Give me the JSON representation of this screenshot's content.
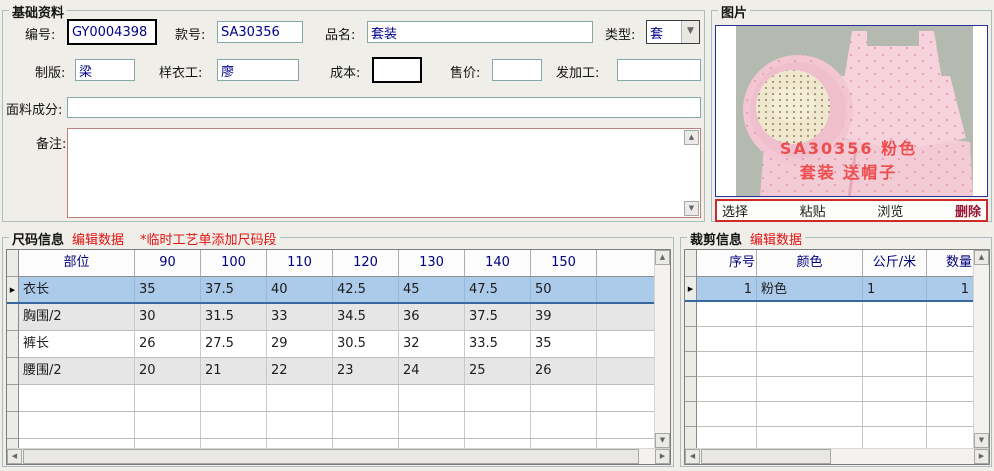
{
  "basic_info": {
    "title": "基础资料",
    "fields": {
      "code_label": "编号:",
      "code_value": "GY0004398",
      "style_label": "款号:",
      "style_value": "SA30356",
      "name_label": "品名:",
      "name_value": "套装",
      "type_label": "类型:",
      "type_value": "套",
      "patternmaker_label": "制版:",
      "patternmaker_value": "梁",
      "sampleworker_label": "样衣工:",
      "sampleworker_value": "廖",
      "cost_label": "成本:",
      "cost_value": "",
      "price_label": "售价:",
      "price_value": "",
      "outsource_label": "发加工:",
      "outsource_value": "",
      "fabric_label": "面料成分:",
      "fabric_value": "",
      "memo_label": "备注:",
      "memo_value": ""
    }
  },
  "picture": {
    "title": "图片",
    "caption_line1": "SA30356 粉色",
    "caption_line2": "套装 送帽子",
    "actions": {
      "select": "选择",
      "paste": "粘贴",
      "browse": "浏览",
      "delete": "删除"
    }
  },
  "size_info": {
    "title": "尺码信息",
    "edit_link": "编辑数据",
    "note": "*临时工艺单添加尺码段",
    "table": {
      "headers": [
        "部位",
        "90",
        "100",
        "110",
        "120",
        "130",
        "140",
        "150",
        ""
      ],
      "rows": [
        [
          "衣长",
          "35",
          "37.5",
          "40",
          "42.5",
          "45",
          "47.5",
          "50",
          ""
        ],
        [
          "胸围/2",
          "30",
          "31.5",
          "33",
          "34.5",
          "36",
          "37.5",
          "39",
          ""
        ],
        [
          "裤长",
          "26",
          "27.5",
          "29",
          "30.5",
          "32",
          "33.5",
          "35",
          ""
        ],
        [
          "腰围/2",
          "20",
          "21",
          "22",
          "23",
          "24",
          "25",
          "26",
          ""
        ]
      ],
      "selected_row": 0,
      "filler_rows": 3
    }
  },
  "cut_info": {
    "title": "裁剪信息",
    "edit_link": "编辑数据",
    "table": {
      "headers": [
        "序号",
        "颜色",
        "公斤/米",
        "数量"
      ],
      "rows": [
        [
          "1",
          "粉色",
          "1",
          "1"
        ]
      ],
      "selected_row": 0,
      "filler_rows": 7
    }
  },
  "colors": {
    "selected_row_bg": "#accae9",
    "link_red": "#e31212",
    "caption_red": "#ee4d4d",
    "delete_maroon": "#991634",
    "input_text_navy": "#00008b",
    "teal_border": "#84a7a7"
  }
}
